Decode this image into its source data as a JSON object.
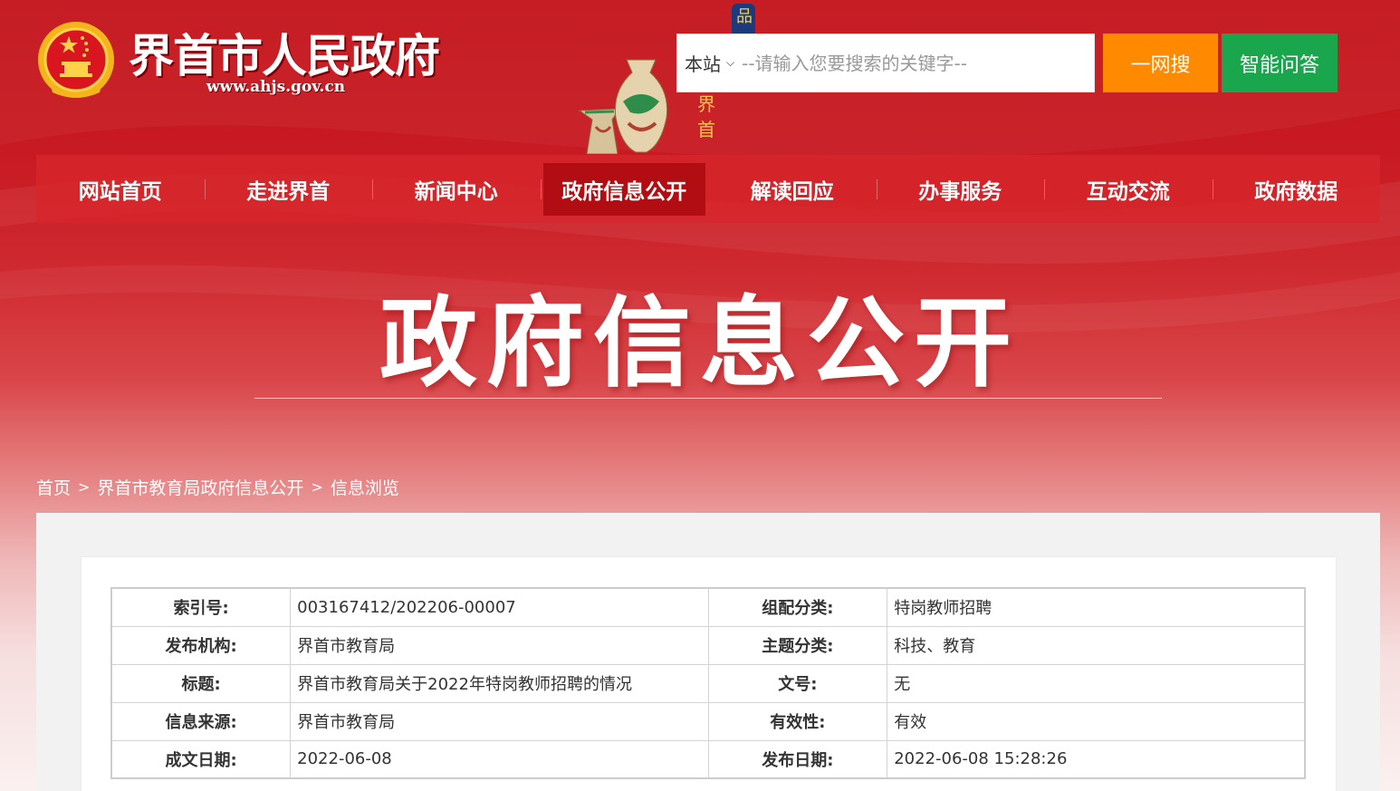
{
  "header": {
    "site_title": "界首市人民政府",
    "site_url": "www.ahjs.gov.cn"
  },
  "search": {
    "scope": "本站",
    "placeholder": "--请输入您要搜索的关键字--",
    "search_button": "一网搜",
    "qa_button": "智能问答"
  },
  "nav": {
    "items": [
      {
        "label": "网站首页"
      },
      {
        "label": "走进界首"
      },
      {
        "label": "新闻中心"
      },
      {
        "label": "政府信息公开",
        "active": true
      },
      {
        "label": "解读回应"
      },
      {
        "label": "办事服务"
      },
      {
        "label": "互动交流"
      },
      {
        "label": "政府数据"
      }
    ]
  },
  "banner": {
    "title": "政府信息公开"
  },
  "breadcrumb": {
    "items": [
      "首页",
      "界首市教育局政府信息公开",
      "信息浏览"
    ],
    "separator": ">"
  },
  "meta_table": {
    "rows": [
      {
        "l1": "索引号:",
        "v1": "003167412/202206-00007",
        "l2": "组配分类:",
        "v2": "特岗教师招聘"
      },
      {
        "l1": "发布机构:",
        "v1": "界首市教育局",
        "l2": "主题分类:",
        "v2": "科技、教育"
      },
      {
        "l1": "标题:",
        "v1": "界首市教育局关于2022年特岗教师招聘的情况",
        "l2": "文号:",
        "v2": "无"
      },
      {
        "l1": "信息来源:",
        "v1": "界首市教育局",
        "l2": "有效性:",
        "v2": "有效"
      },
      {
        "l1": "成文日期:",
        "v1": "2022-06-08",
        "l2": "发布日期:",
        "v2": "2022-06-08 15:28:26"
      }
    ]
  },
  "colors": {
    "primary_red": "#c4141c",
    "nav_active": "#b30d14",
    "search_orange": "#ff8a00",
    "qa_green": "#1aa64c"
  },
  "icons": {
    "emblem": "national-emblem-icon",
    "dropdown": "chevron-down-icon"
  }
}
